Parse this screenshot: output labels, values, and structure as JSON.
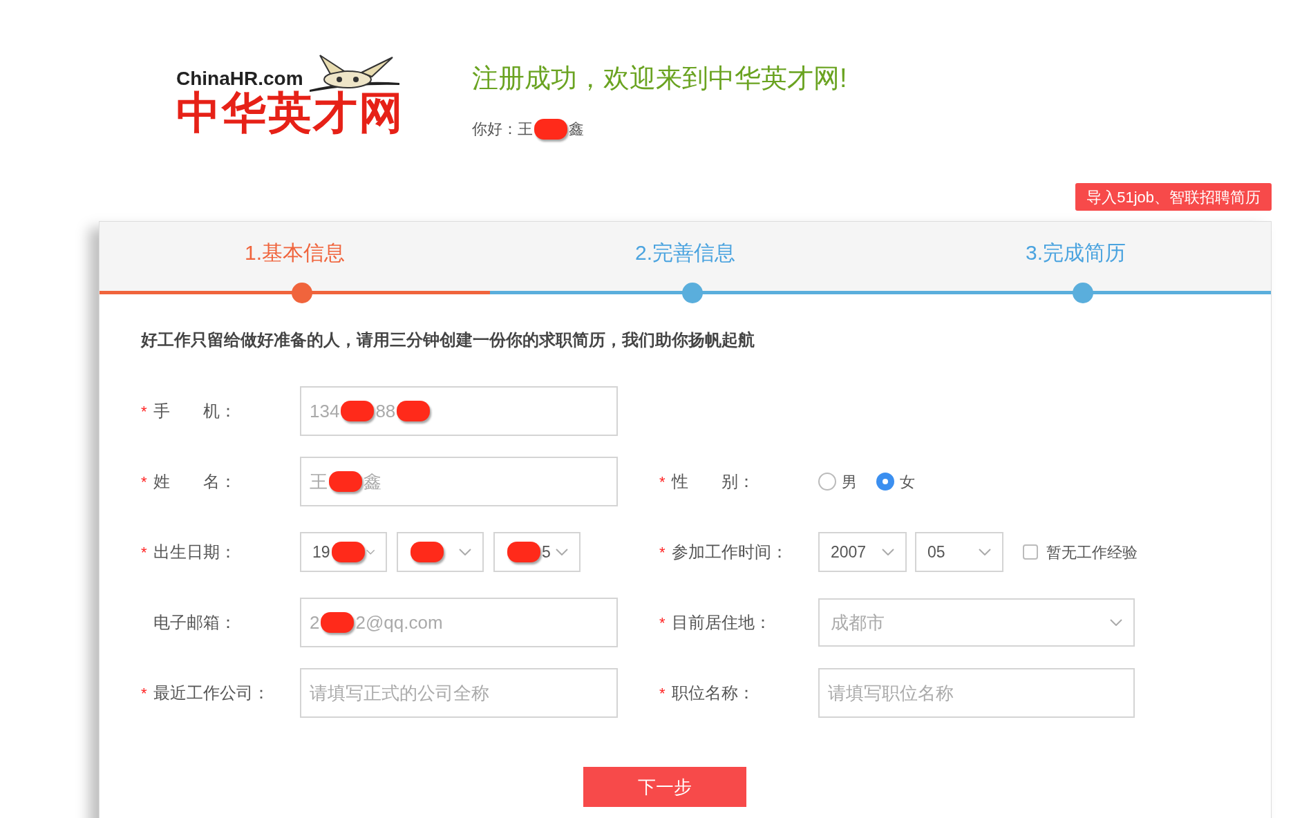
{
  "logo": {
    "domain": "ChinaHR.com",
    "name": "中华英才网"
  },
  "header": {
    "title": "注册成功，欢迎来到中华英才网!",
    "greeting_label": "你好：",
    "greeting_name": [
      {
        "kind": "text",
        "text": "王"
      },
      {
        "kind": "redaction"
      },
      {
        "kind": "text",
        "text": "鑫"
      }
    ]
  },
  "import_button": "导入51job、智联招聘简历",
  "steps": [
    {
      "label": "1.基本信息",
      "selected": true
    },
    {
      "label": "2.完善信息",
      "selected": false
    },
    {
      "label": "3.完成简历",
      "selected": false
    }
  ],
  "intro": "好工作只留给做好准备的人，请用三分钟创建一份你的求职简历，我们助你扬帆起航",
  "form": {
    "phone": {
      "label": "手　　机：",
      "mark": "*",
      "value": [
        {
          "kind": "text",
          "text": "134"
        },
        {
          "kind": "redaction"
        },
        {
          "kind": "text",
          "text": "88"
        },
        {
          "kind": "redaction"
        }
      ]
    },
    "name": {
      "label": "姓　　名：",
      "mark": "*",
      "value": [
        {
          "kind": "text",
          "text": "王"
        },
        {
          "kind": "redaction"
        },
        {
          "kind": "text",
          "text": "鑫"
        }
      ]
    },
    "gender": {
      "label": "性　　别：",
      "mark": "*",
      "options": [
        {
          "label": "男",
          "selected": false
        },
        {
          "label": "女",
          "selected": true
        }
      ]
    },
    "birth_date": {
      "label": "出生日期：",
      "mark": "*",
      "year": [
        {
          "kind": "text",
          "text": "19"
        },
        {
          "kind": "redaction"
        }
      ],
      "month": [
        {
          "kind": "redaction"
        }
      ],
      "day": [
        {
          "kind": "redaction"
        },
        {
          "kind": "text",
          "text": "5"
        }
      ]
    },
    "work_start": {
      "label": "参加工作时间：",
      "mark": "*",
      "year": "2007",
      "month": "05",
      "no_experience": {
        "label": "暂无工作经验",
        "checked": false
      }
    },
    "email": {
      "label": "电子邮箱：",
      "value": [
        {
          "kind": "text",
          "text": "2"
        },
        {
          "kind": "redaction"
        },
        {
          "kind": "text",
          "text": "2@qq.com"
        }
      ]
    },
    "residence": {
      "label": "目前居住地：",
      "mark": "*",
      "value": "成都市"
    },
    "company": {
      "label": "最近工作公司：",
      "mark": "*",
      "placeholder": "请填写正式的公司全称"
    },
    "position": {
      "label": "职位名称：",
      "mark": "*",
      "placeholder": "请填写职位名称"
    }
  },
  "next_button": "下一步"
}
